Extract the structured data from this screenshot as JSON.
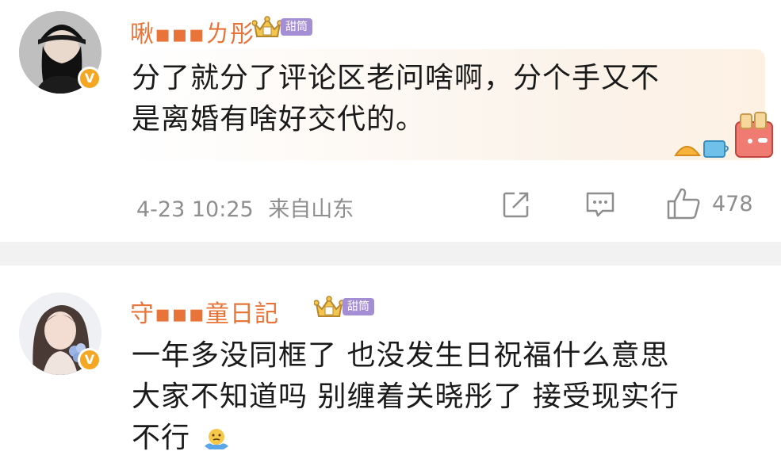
{
  "comments": [
    {
      "username": "啾▪▪▪ㄌ彤",
      "tag": "甜筒",
      "content_lines": [
        "分了就分了评论区老问啥啊，分个手又不",
        "是离婚有啥好交代的。"
      ],
      "time": "4-23 10:25",
      "location": "来自山东",
      "likes": "478",
      "badge": "V",
      "icons": [
        "avatar-woman-black-cap",
        "crown-icon",
        "share-icon",
        "comment-icon",
        "like-icon",
        "breakfast-sticker"
      ]
    },
    {
      "username": "守▪▪▪童日記",
      "tag": "甜筒",
      "content_lines": [
        "一年多没同框了 也没发生日祝福什么意思",
        "大家不知道吗 别缠着关晓彤了 接受现实行",
        "不行"
      ],
      "emoji": "shrug-emoji",
      "badge": "V",
      "icons": [
        "avatar-woman-flowers",
        "crown-icon"
      ]
    }
  ],
  "colors": {
    "username": "#e8743a",
    "tag": "#a58fd4",
    "meta": "#8e8e8e",
    "badge": "#f5a623",
    "divider": "#f2f2f2"
  }
}
